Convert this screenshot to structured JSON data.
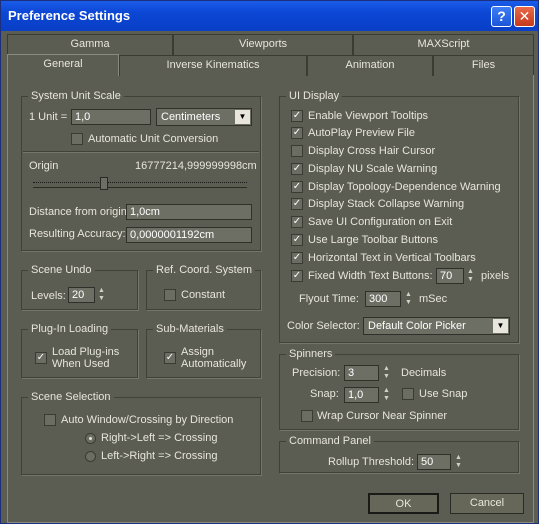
{
  "window": {
    "title": "Preference Settings",
    "help_glyph": "?",
    "close_glyph": "✕"
  },
  "tabs_row1": [
    "Gamma",
    "Viewports",
    "MAXScript"
  ],
  "tabs_row2": [
    "General",
    "Inverse Kinematics",
    "Animation",
    "Files"
  ],
  "system_unit_scale": {
    "title": "System Unit Scale",
    "unit_label": "1 Unit =",
    "unit_value": "1,0",
    "unit_type": "Centimeters",
    "auto_convert": "Automatic Unit Conversion",
    "origin_label": "Origin",
    "origin_value": "16777214,999999998cm",
    "distance_label": "Distance from origin:",
    "distance_value": "1,0cm",
    "accuracy_label": "Resulting Accuracy:",
    "accuracy_value": "0,0000001192cm"
  },
  "scene_undo": {
    "title": "Scene Undo",
    "levels_label": "Levels:",
    "levels_value": "20"
  },
  "ref_coord": {
    "title": "Ref. Coord. System",
    "constant": "Constant"
  },
  "plugin_loading": {
    "title": "Plug-In Loading",
    "load_line1": "Load Plug-ins",
    "load_line2": "When Used"
  },
  "sub_materials": {
    "title": "Sub-Materials",
    "assign_line1": "Assign",
    "assign_line2": "Automatically"
  },
  "scene_selection": {
    "title": "Scene Selection",
    "auto_window": "Auto Window/Crossing by Direction",
    "opt1": "Right->Left => Crossing",
    "opt2": "Left->Right => Crossing"
  },
  "ui_display": {
    "title": "UI Display",
    "items": [
      {
        "label": "Enable Viewport Tooltips",
        "checked": "✓"
      },
      {
        "label": "AutoPlay Preview File",
        "checked": "✓"
      },
      {
        "label": "Display Cross Hair Cursor",
        "checked": ""
      },
      {
        "label": "Display NU Scale Warning",
        "checked": "✓"
      },
      {
        "label": "Display Topology-Dependence Warning",
        "checked": "✓"
      },
      {
        "label": "Display Stack Collapse Warning",
        "checked": "✓"
      },
      {
        "label": "Save UI Configuration on Exit",
        "checked": "✓"
      },
      {
        "label": "Use Large Toolbar Buttons",
        "checked": "✓"
      },
      {
        "label": "Horizontal Text in Vertical Toolbars",
        "checked": "✓"
      },
      {
        "label": "Fixed Width Text Buttons:",
        "checked": "✓"
      }
    ],
    "fixed_width_value": "70",
    "pixels": "pixels",
    "flyout_label": "Flyout Time:",
    "flyout_value": "300",
    "msec": "mSec",
    "color_selector_label": "Color Selector:",
    "color_selector_value": "Default Color Picker"
  },
  "spinners": {
    "title": "Spinners",
    "precision_label": "Precision:",
    "precision_value": "3",
    "decimals": "Decimals",
    "snap_label": "Snap:",
    "snap_value": "1,0",
    "use_snap": "Use Snap",
    "wrap": "Wrap Cursor Near Spinner"
  },
  "command_panel": {
    "title": "Command Panel",
    "rollup_label": "Rollup Threshold:",
    "rollup_value": "50"
  },
  "buttons": {
    "ok": "OK",
    "cancel": "Cancel"
  },
  "check_glyph": "✓",
  "spin_up": "▲",
  "spin_down": "▼",
  "combo_arrow": "▼"
}
